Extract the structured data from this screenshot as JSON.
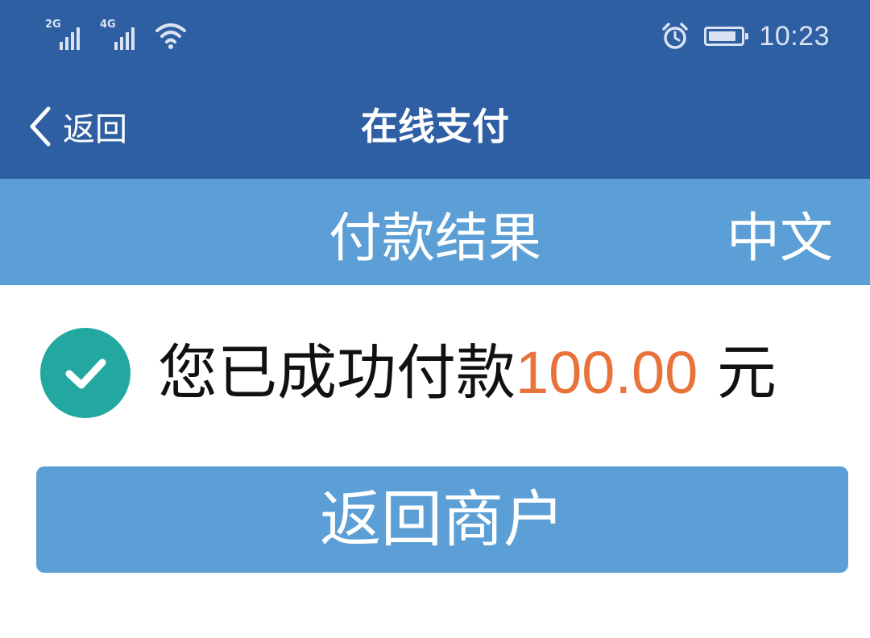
{
  "status_bar": {
    "signal_1_label": "2G",
    "signal_2_label": "4G",
    "battery_level": 0.85,
    "time": "10:23"
  },
  "nav": {
    "back_label": "返回",
    "title": "在线支付"
  },
  "sub_header": {
    "title": "付款结果",
    "language_toggle": "中文"
  },
  "result": {
    "message_prefix": "您已成功付款",
    "amount": "100.00",
    "currency_suffix": "元"
  },
  "actions": {
    "return_merchant_label": "返回商户"
  },
  "icons": {
    "status_left": [
      "signal-icon",
      "signal-icon",
      "wifi-icon"
    ],
    "status_right": [
      "alarm-icon",
      "battery-icon"
    ],
    "nav_back": "chevron-left-icon",
    "result": "check-circle-icon"
  },
  "colors": {
    "nav_bar": "#2f5fa3",
    "sub_header": "#5b9fd6",
    "button": "#5b9fd6",
    "success": "#22a8a0",
    "amount": "#e8733a"
  }
}
